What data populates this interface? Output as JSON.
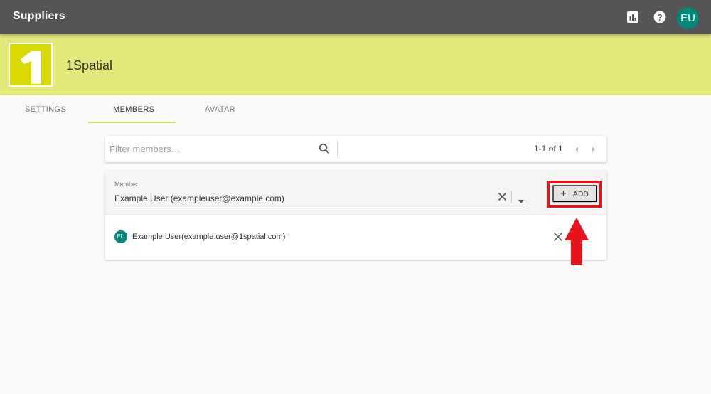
{
  "header": {
    "title": "Suppliers",
    "icons": [
      "report-icon",
      "help-icon"
    ],
    "user_initials": "EU",
    "bg_color": "#555555"
  },
  "banner": {
    "org_name": "1Spatial",
    "logo_text": "1",
    "bg_color": "#e4e77a",
    "logo_color": "#d9d800"
  },
  "tabs": [
    {
      "label": "SETTINGS",
      "active": false
    },
    {
      "label": "MEMBERS",
      "active": true
    },
    {
      "label": "AVATAR",
      "active": false
    }
  ],
  "filter": {
    "placeholder": "Filter members…",
    "page_range": "1-1 of 1"
  },
  "member_form": {
    "label": "Member",
    "value": "Example User (exampleuser@example.com)",
    "add_label": "ADD"
  },
  "members": [
    {
      "initials": "EU",
      "name": "Example User(example.user@1spatial.com)"
    }
  ],
  "annotation": {
    "highlight_color": "#e8141c"
  },
  "colors": {
    "accent": "#d8dd55",
    "avatar": "#00897b"
  }
}
